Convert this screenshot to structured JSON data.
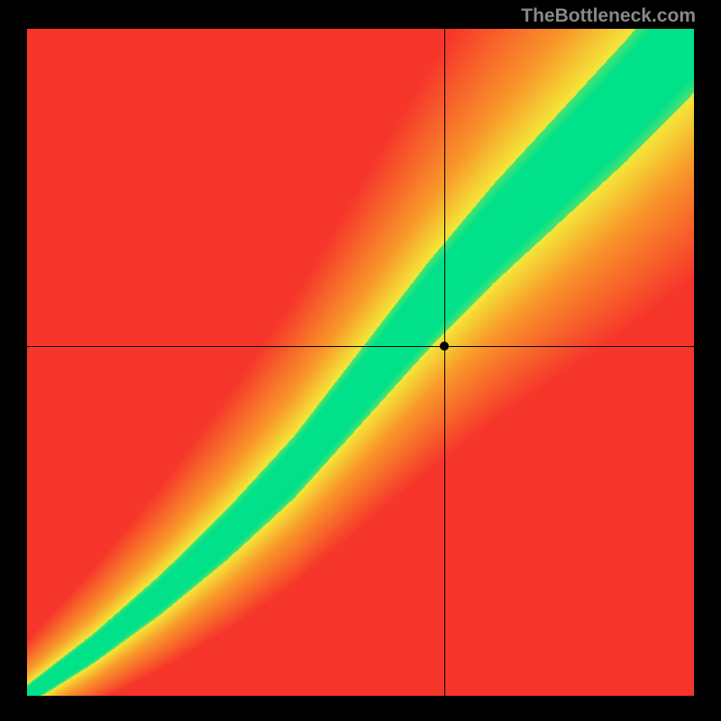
{
  "watermark": "TheBottleneck.com",
  "chart_data": {
    "type": "heatmap",
    "title": "",
    "xlabel": "",
    "ylabel": "",
    "xlim": [
      0,
      1
    ],
    "ylim": [
      0,
      1
    ],
    "crosshair": {
      "x": 0.625,
      "y": 0.525
    },
    "marker": {
      "x": 0.625,
      "y": 0.525
    },
    "optimal_band": {
      "description": "Green optimal region along a slightly S-curved diagonal, widening toward top-right; surrounded by yellow transition; corners red.",
      "center_curve_samples": [
        {
          "x": 0.0,
          "y": 0.0
        },
        {
          "x": 0.1,
          "y": 0.07
        },
        {
          "x": 0.2,
          "y": 0.15
        },
        {
          "x": 0.3,
          "y": 0.24
        },
        {
          "x": 0.4,
          "y": 0.34
        },
        {
          "x": 0.5,
          "y": 0.46
        },
        {
          "x": 0.6,
          "y": 0.58
        },
        {
          "x": 0.7,
          "y": 0.69
        },
        {
          "x": 0.8,
          "y": 0.79
        },
        {
          "x": 0.9,
          "y": 0.89
        },
        {
          "x": 1.0,
          "y": 1.0
        }
      ],
      "band_halfwidth_at_0": 0.015,
      "band_halfwidth_at_1": 0.1
    },
    "color_stops": {
      "optimal": "#00e28a",
      "near": "#f4e93a",
      "mid": "#f99a2a",
      "far": "#f6352b"
    }
  }
}
